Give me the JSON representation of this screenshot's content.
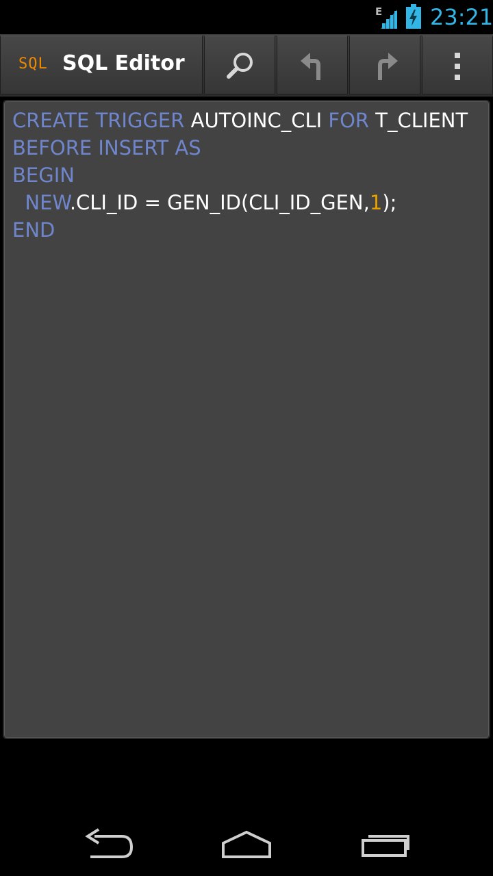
{
  "status_bar": {
    "network_type": "E",
    "time": "23:21",
    "colors": {
      "time": "#33b5e5",
      "icons": "#33b5e5"
    }
  },
  "action_bar": {
    "logo_text": "SQL",
    "title": "SQL Editor",
    "actions": [
      {
        "icon": "search-icon"
      },
      {
        "icon": "undo-icon"
      },
      {
        "icon": "redo-icon"
      },
      {
        "icon": "overflow-menu-icon"
      }
    ],
    "colors": {
      "logo": "#ef8a00",
      "title": "#ffffff"
    }
  },
  "editor": {
    "colors": {
      "keyword": "#6f86cc",
      "identifier": "#ffffff",
      "number": "#e8a200",
      "background": "#434343"
    },
    "lines": [
      {
        "tokens": [
          {
            "text": "CREATE TRIGGER ",
            "type": "kw"
          },
          {
            "text": "AUTOINC_CLI ",
            "type": "ident"
          },
          {
            "text": "FOR ",
            "type": "kw"
          },
          {
            "text": "T_CLIENT",
            "type": "ident"
          }
        ]
      },
      {
        "tokens": [
          {
            "text": "BEFORE INSERT AS",
            "type": "kw"
          }
        ]
      },
      {
        "tokens": [
          {
            "text": "BEGIN",
            "type": "kw"
          }
        ]
      },
      {
        "tokens": [
          {
            "text": "  NEW",
            "type": "kw"
          },
          {
            "text": ".CLI_ID = GEN_ID(CLI_ID_GEN,",
            "type": "ident"
          },
          {
            "text": "1",
            "type": "num"
          },
          {
            "text": ");",
            "type": "ident"
          }
        ]
      },
      {
        "tokens": [
          {
            "text": "END",
            "type": "kw"
          }
        ]
      }
    ]
  },
  "nav_bar": {
    "buttons": [
      {
        "icon": "back-icon"
      },
      {
        "icon": "home-icon"
      },
      {
        "icon": "recent-apps-icon"
      }
    ]
  }
}
